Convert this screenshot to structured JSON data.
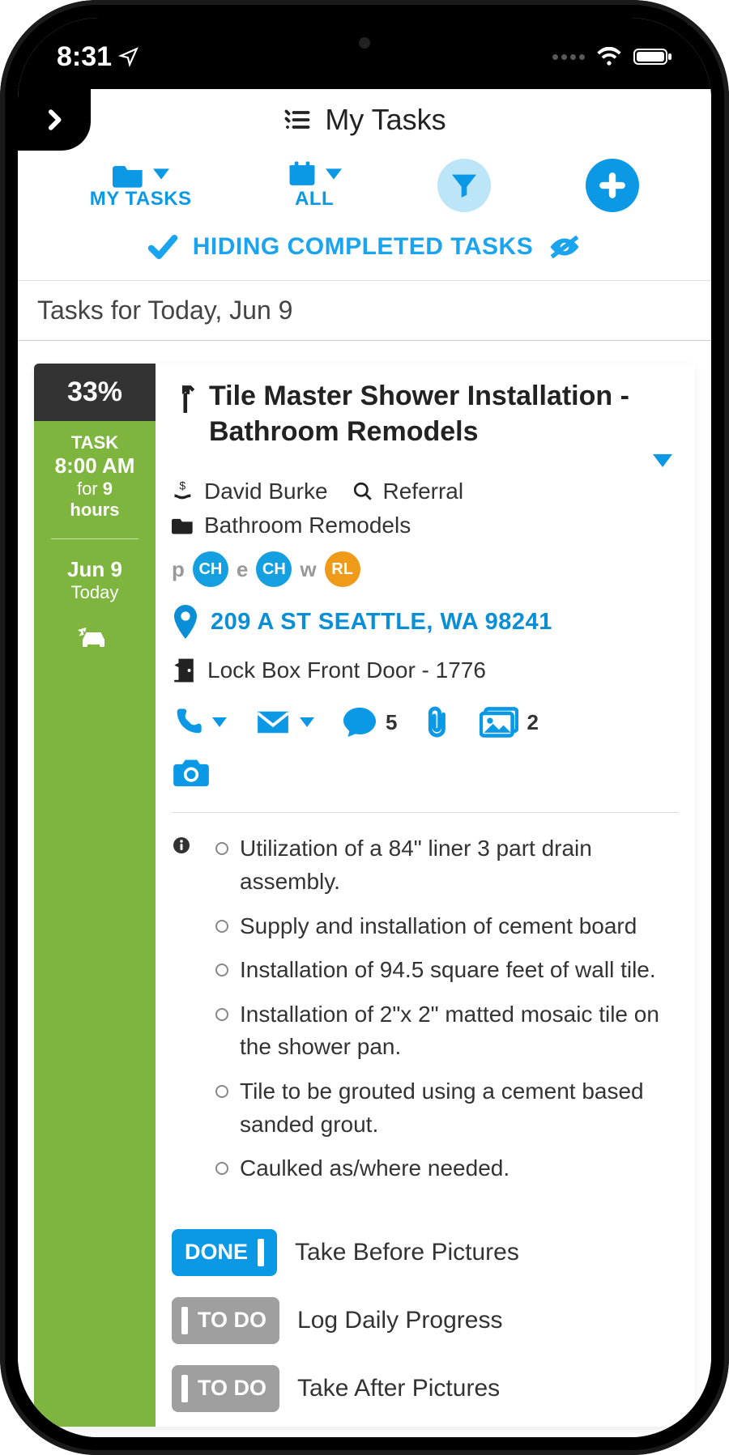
{
  "status": {
    "time": "8:31"
  },
  "header": {
    "title": "My Tasks"
  },
  "tabs": {
    "my_tasks": "MY TASKS",
    "all": "ALL"
  },
  "hiding_label": "HIDING COMPLETED TASKS",
  "section_label": "Tasks for Today, Jun 9",
  "task": {
    "percent": "33%",
    "time_label": "TASK",
    "start": "8:00 AM",
    "for": "for",
    "hours_num": "9",
    "hours_word": "hours",
    "date": "Jun 9",
    "today": "Today",
    "title": "Tile Master Shower Installation - Bathroom Remodels",
    "contact": "David Burke",
    "source": "Referral",
    "project": "Bathroom Remodels",
    "assignees": {
      "p_label": "p",
      "p": "CH",
      "e_label": "e",
      "e": "CH",
      "w_label": "w",
      "w": "RL"
    },
    "address": "209 A ST SEATTLE, WA 98241",
    "lockbox": "Lock Box Front Door - 1776",
    "comment_count": "5",
    "image_count": "2",
    "desc": [
      "Utilization of a 84\" liner 3 part drain assembly.",
      "Supply and installation of cement board",
      "Installation of 94.5 square feet of wall tile.",
      "Installation of 2\"x 2\" matted mosaic tile on the shower pan.",
      "Tile to be grouted using a cement based sanded grout.",
      "Caulked as/where needed."
    ],
    "subtasks": [
      {
        "status": "DONE",
        "label": "Take Before Pictures"
      },
      {
        "status": "TO DO",
        "label": "Log Daily Progress"
      },
      {
        "status": "TO DO",
        "label": "Take After Pictures"
      }
    ]
  }
}
